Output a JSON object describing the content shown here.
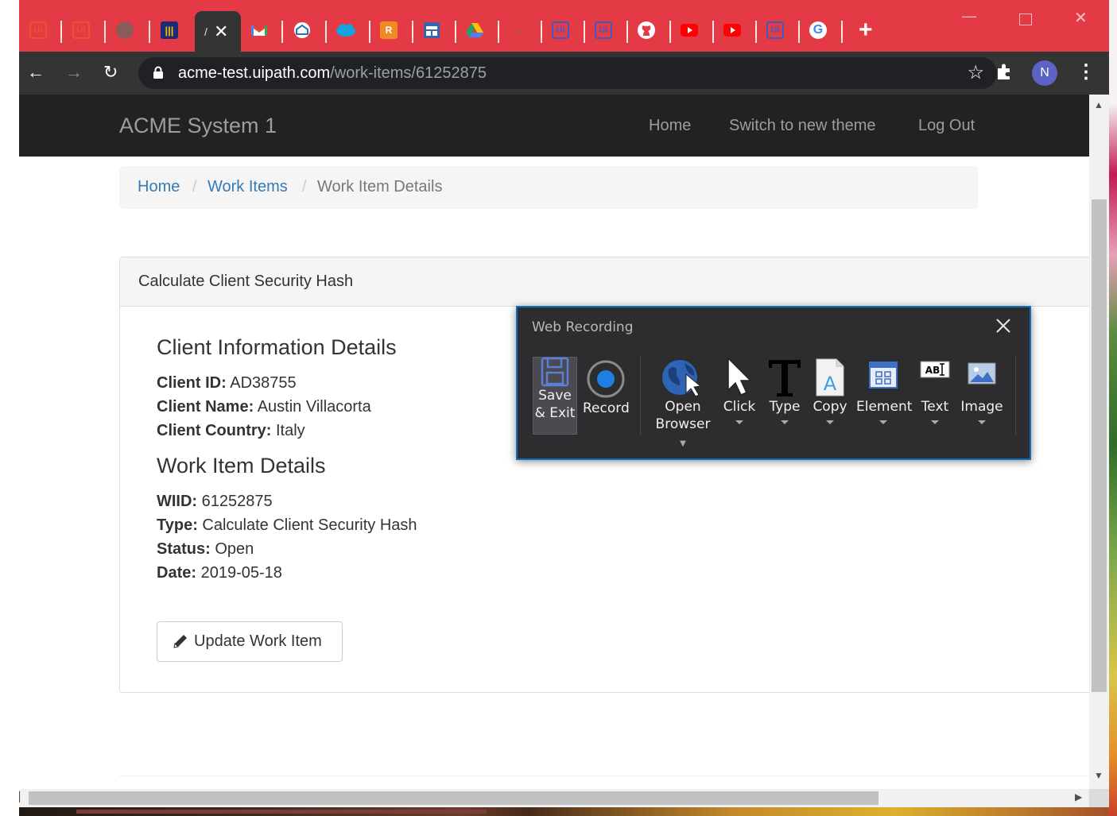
{
  "browser": {
    "tabs": [
      {
        "favicon": "uipath-icon",
        "color": "#e8542e",
        "text": "Ui"
      },
      {
        "favicon": "uipath-icon",
        "color": "#e8542e",
        "text": "Ui"
      },
      {
        "favicon": "globe-icon",
        "color": "#7a5a5a",
        "text": ""
      },
      {
        "favicon": "audio-wave-icon",
        "color": "#1d2a75",
        "text": ""
      },
      {
        "favicon": "gmail-icon",
        "color": "#e33a46",
        "text": ""
      },
      {
        "favicon": "mail-icon",
        "color": "#2f6fb5",
        "text": ""
      },
      {
        "favicon": "salesforce-icon",
        "color": "#14a2e0",
        "text": ""
      },
      {
        "favicon": "r-icon",
        "color": "#f08a24",
        "text": "R"
      },
      {
        "favicon": "calendar-icon",
        "color": "#3464b3",
        "text": ""
      },
      {
        "favicon": "google-drive-icon",
        "color": "#1fa463",
        "text": ""
      },
      {
        "favicon": "app-icon",
        "color": "#c84a4a",
        "text": ""
      },
      {
        "favicon": "uipath-icon",
        "color": "#3f5bbf",
        "text": "Ui"
      },
      {
        "favicon": "uipath-icon",
        "color": "#3f5bbf",
        "text": "Ui"
      },
      {
        "favicon": "github-icon",
        "color": "#ffffff",
        "text": ""
      },
      {
        "favicon": "youtube-icon",
        "color": "#ff0000",
        "text": ""
      },
      {
        "favicon": "youtube-icon",
        "color": "#ff0000",
        "text": ""
      },
      {
        "favicon": "uipath-icon",
        "color": "#3f5bbf",
        "text": "Ui"
      },
      {
        "favicon": "google-icon",
        "color": "#ffffff",
        "text": "G"
      }
    ],
    "active_tab_close": "✕",
    "new_tab": "+",
    "url_host": "acme-test.uipath.com",
    "url_path": "/work-items/61252875",
    "profile_initial": "N",
    "accent": "#e33a46"
  },
  "site": {
    "brand": "ACME System 1",
    "nav": {
      "home": "Home",
      "theme": "Switch to new theme",
      "logout": "Log Out"
    },
    "breadcrumb": {
      "home": "Home",
      "work_items": "Work Items",
      "current": "Work Item Details",
      "sep": "/"
    },
    "panel_title": "Calculate Client Security Hash",
    "client_heading": "Client Information Details",
    "client": {
      "id_label": "Client ID:",
      "id": "AD38755",
      "name_label": "Client Name:",
      "name": "Austin Villacorta",
      "country_label": "Client Country:",
      "country": "Italy"
    },
    "work_heading": "Work Item Details",
    "work": {
      "wiid_label": "WIID:",
      "wiid": "61252875",
      "type_label": "Type:",
      "type": "Calculate Client Security Hash",
      "status_label": "Status:",
      "status": "Open",
      "date_label": "Date:",
      "date": "2019-05-18"
    },
    "update_button": "Update Work Item"
  },
  "recorder": {
    "title": "Web Recording",
    "items": [
      {
        "line1": "Save",
        "line2": "& Exit",
        "icon": "save-icon"
      },
      {
        "line1": "Record",
        "line2": "",
        "icon": "record-icon"
      },
      {
        "line1": "Open",
        "line2": "Browser",
        "icon": "globe-cursor-icon"
      },
      {
        "line1": "Click",
        "line2": "",
        "icon": "cursor-icon"
      },
      {
        "line1": "Type",
        "line2": "",
        "icon": "type-icon"
      },
      {
        "line1": "Copy",
        "line2": "",
        "icon": "copy-icon"
      },
      {
        "line1": "Element",
        "line2": "",
        "icon": "element-icon"
      },
      {
        "line1": "Text",
        "line2": "",
        "icon": "text-icon"
      },
      {
        "line1": "Image",
        "line2": "",
        "icon": "image-icon"
      }
    ],
    "border_color": "#0f6fbf"
  }
}
